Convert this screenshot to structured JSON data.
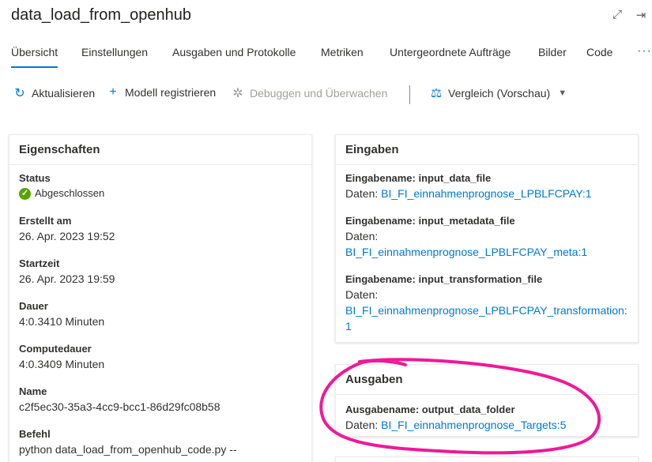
{
  "title": "data_load_from_openhub",
  "tabs": [
    "Übersicht",
    "Einstellungen",
    "Ausgaben und Protokolle",
    "Metriken",
    "Untergeordnete Aufträge",
    "Bilder",
    "Code"
  ],
  "tabs_more": "···",
  "toolbar": {
    "refresh": "Aktualisieren",
    "register": "Modell registrieren",
    "debug": "Debuggen und Überwachen",
    "compare": "Vergleich (Vorschau)"
  },
  "props": {
    "header": "Eigenschaften",
    "status_label": "Status",
    "status_value": "Abgeschlossen",
    "created_label": "Erstellt am",
    "created_value": "26. Apr. 2023 19:52",
    "start_label": "Startzeit",
    "start_value": "26. Apr. 2023 19:59",
    "duration_label": "Dauer",
    "duration_value": "4:0.3410 Minuten",
    "compute_label": "Computedauer",
    "compute_value": "4:0.3409 Minuten",
    "name_label": "Name",
    "name_value": "c2f5ec30-35a3-4cc9-bcc1-86d29fc08b58",
    "command_label": "Befehl",
    "command_value": "python data_load_from_openhub_code.py --"
  },
  "inputs": {
    "header": "Eingaben",
    "items": [
      {
        "label": "Eingabename: input_data_file",
        "prefix": "Daten: ",
        "link": "BI_FI_einnahmenprognose_LPBLFCPAY:1"
      },
      {
        "label": "Eingabename: input_metadata_file",
        "prefix": "Daten: ",
        "link": "BI_FI_einnahmenprognose_LPBLFCPAY_meta:1"
      },
      {
        "label": "Eingabename: input_transformation_file",
        "prefix": "Daten: ",
        "link": "BI_FI_einnahmenprognose_LPBLFCPAY_transformation:1"
      }
    ]
  },
  "outputs": {
    "header": "Ausgaben",
    "items": [
      {
        "label": "Ausgabename: output_data_folder",
        "prefix": "Daten: ",
        "link": "BI_FI_einnahmenprognose_Targets:5"
      }
    ]
  },
  "colors": {
    "accent": "#0078d4",
    "success": "#57a300",
    "annotation": "#f0189a"
  },
  "icons": [
    "expand-icon",
    "panel-icon",
    "refresh-icon",
    "plus-icon",
    "bug-icon",
    "compare-icon",
    "chevron-down-icon",
    "check-icon"
  ]
}
